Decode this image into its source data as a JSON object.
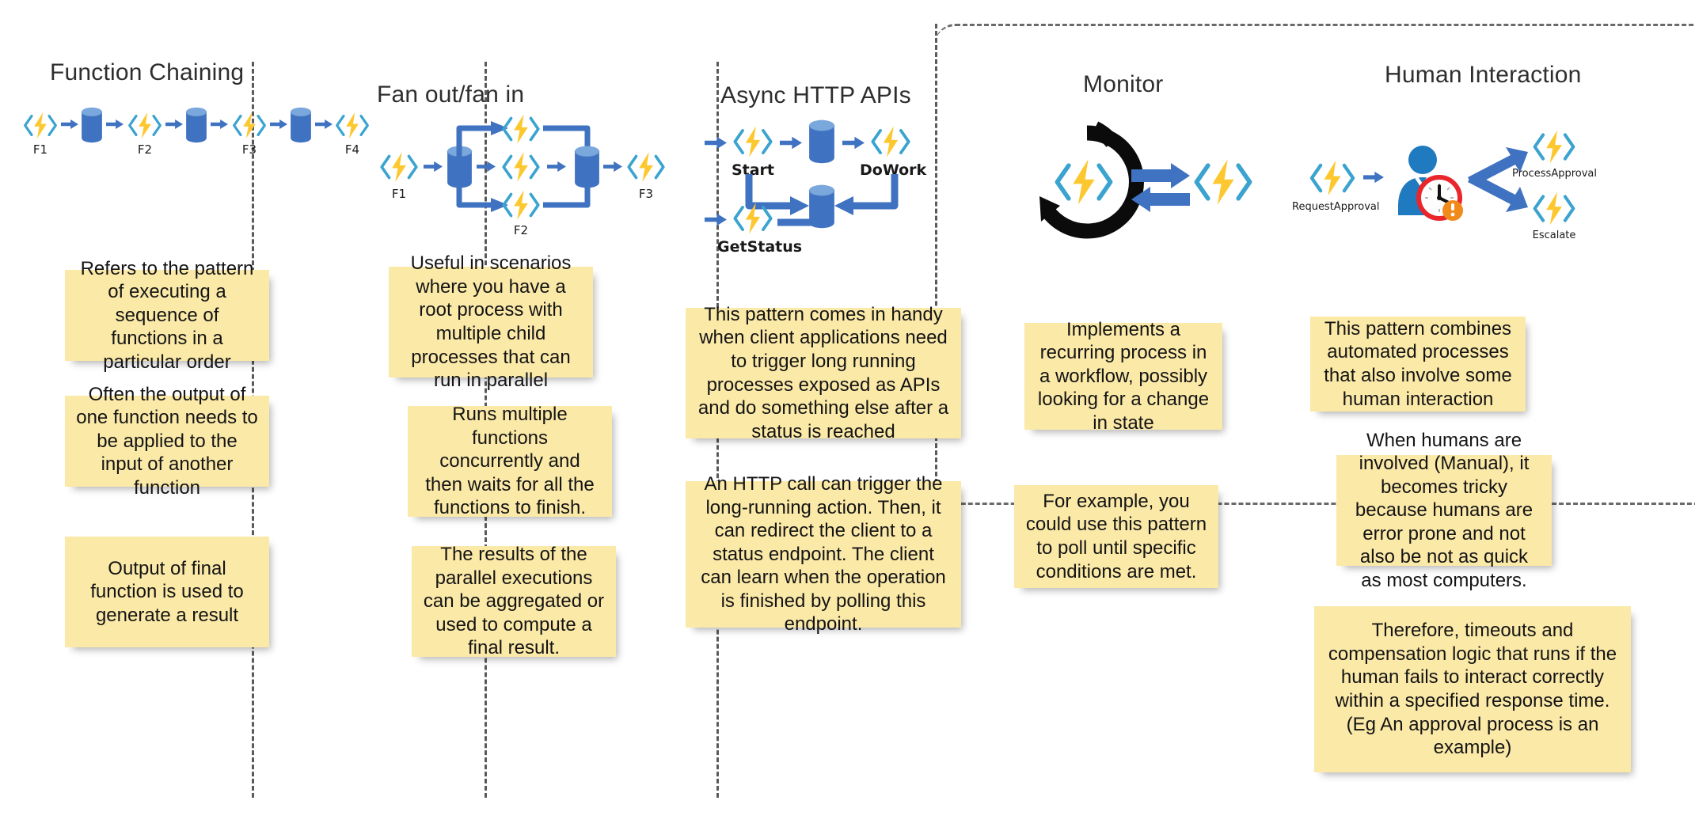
{
  "meta": {
    "title": "Azure Durable Functions Patterns",
    "note_color": "#fbe9a8",
    "accent_blue": "#3f72c1",
    "accent_cyan": "#3aa3d0",
    "accent_yellow": "#fdc82f"
  },
  "columns": [
    {
      "id": "function-chaining",
      "title": "Function Chaining",
      "diagram": {
        "type": "linear-chain",
        "nodes": [
          {
            "kind": "function",
            "label": "F1"
          },
          {
            "kind": "queue",
            "label": ""
          },
          {
            "kind": "function",
            "label": "F2"
          },
          {
            "kind": "queue",
            "label": ""
          },
          {
            "kind": "function",
            "label": "F3"
          },
          {
            "kind": "queue",
            "label": ""
          },
          {
            "kind": "function",
            "label": "F4"
          }
        ]
      },
      "notes": [
        "Refers to the pattern of executing a sequence of functions in a particular order",
        "Often the output of one function needs to be applied to the input of another function",
        "Output of final function is used to generate a result"
      ]
    },
    {
      "id": "fan-out-fan-in",
      "title": "Fan out/fan in",
      "diagram": {
        "type": "fan-out-fan-in",
        "labels": {
          "start": "F1",
          "parallel": "F2",
          "end": "F3"
        },
        "parallel_count": 3
      },
      "notes": [
        "Useful in scenarios where you have a root process with multiple child processes that can run in parallel",
        "Runs multiple functions concurrently and then waits for all the functions to finish.",
        "The results of the parallel executions can be aggregated or used to compute a final result."
      ]
    },
    {
      "id": "async-http-apis",
      "title": "Async HTTP APIs",
      "diagram": {
        "type": "async-http",
        "labels": {
          "start": "Start",
          "dowork": "DoWork",
          "getstatus": "GetStatus"
        }
      },
      "notes": [
        "This pattern comes in handy when client applications need to trigger long running processes exposed as APIs and do something else after a status is reached",
        "An HTTP call can trigger the long-running action. Then, it can redirect the client to a status endpoint. The client can learn when the operation is finished by polling this endpoint."
      ]
    },
    {
      "id": "monitor",
      "title": "Monitor",
      "diagram": {
        "type": "monitor-loop"
      },
      "notes": [
        "Implements a recurring process in a workflow, possibly looking for a change in state",
        "For example, you could use this pattern to poll until specific conditions are met."
      ]
    },
    {
      "id": "human-interaction",
      "title": "Human Interaction",
      "diagram": {
        "type": "human-interaction",
        "labels": {
          "request": "RequestApproval",
          "approve": "ProcessApproval",
          "escalate": "Escalate"
        }
      },
      "notes": [
        "This pattern combines automated processes that also involve some human interaction",
        "When humans are involved (Manual), it becomes tricky because humans are error prone and  not  also be not as quick as most computers.",
        "Therefore, timeouts and compensation logic that runs if the human fails to interact correctly within a specified response time. (Eg An approval process is an example)"
      ]
    }
  ]
}
